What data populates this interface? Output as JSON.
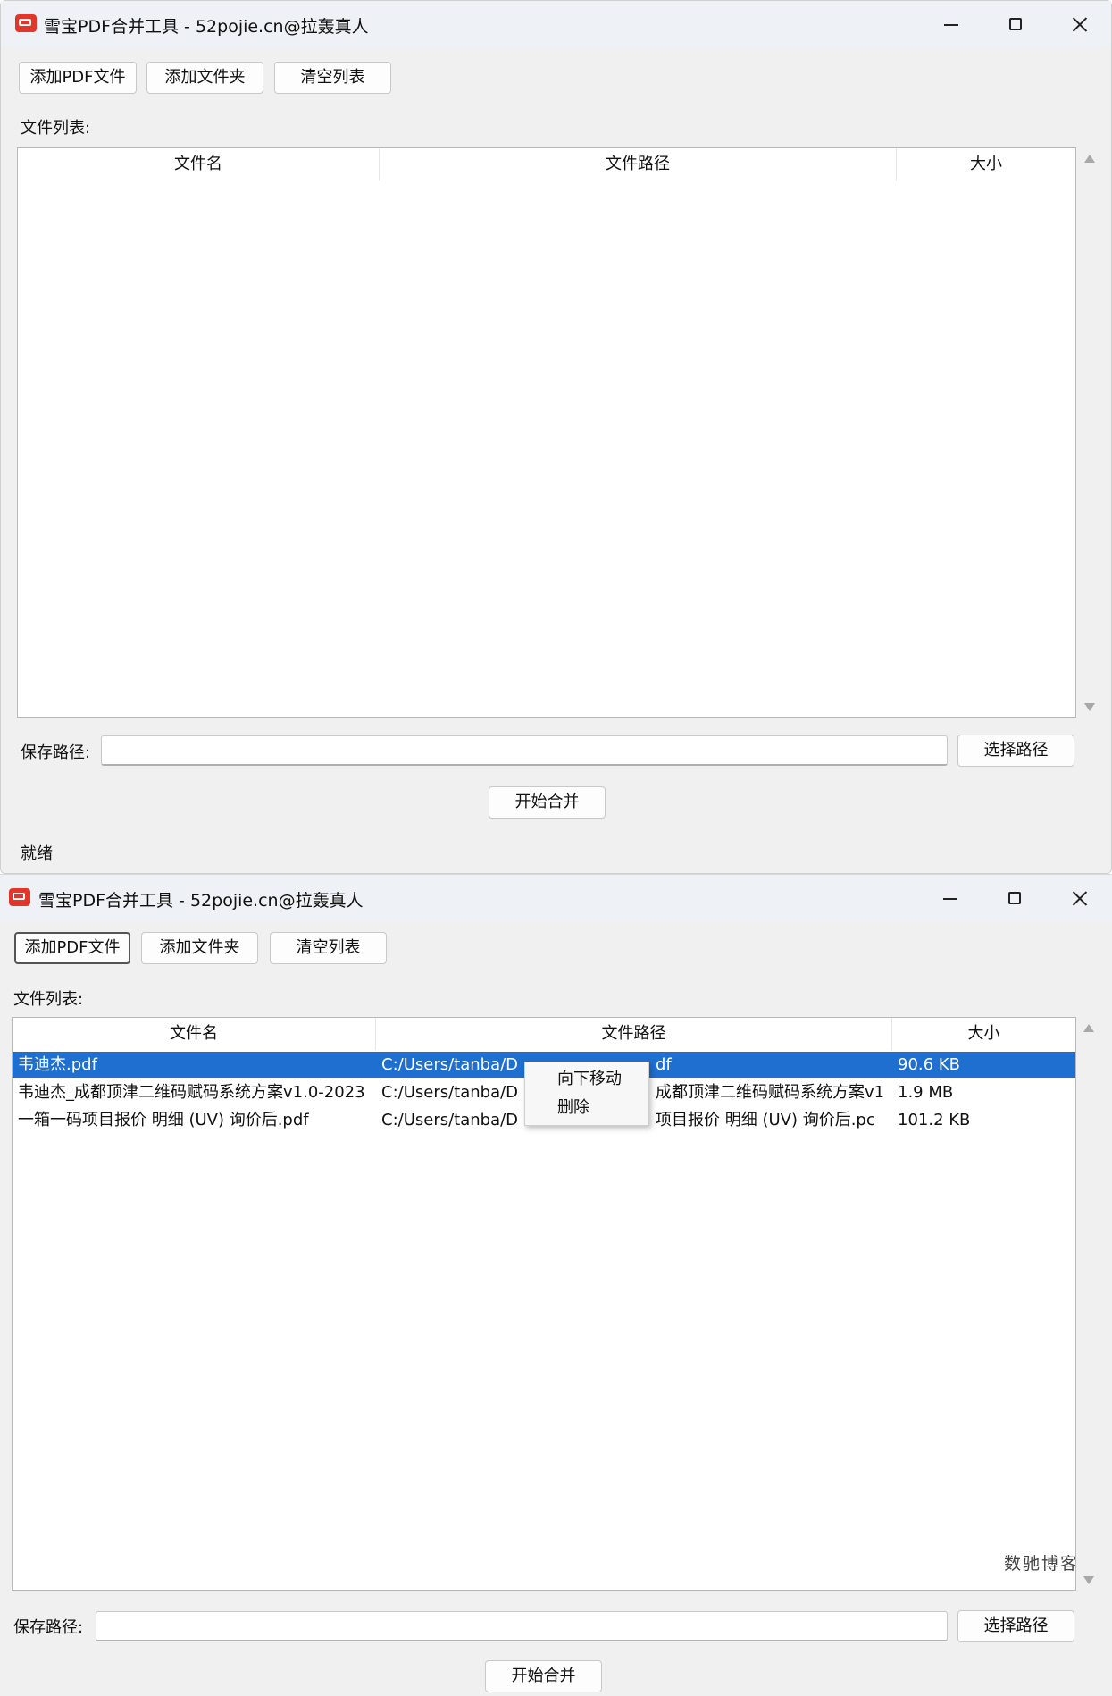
{
  "window_title": "雪宝PDF合并工具 - 52pojie.cn@拉轰真人",
  "toolbar": {
    "add_pdf": "添加PDF文件",
    "add_folder": "添加文件夹",
    "clear_list": "清空列表"
  },
  "file_list_label": "文件列表:",
  "columns": [
    "文件名",
    "文件路径",
    "大小"
  ],
  "save_path_label": "保存路径:",
  "save_path_value": "",
  "choose_path_button": "选择路径",
  "start_merge_button": "开始合并",
  "status_text": "就绪",
  "files": [
    {
      "name": "韦迪杰.pdf",
      "path": "C:/Users/tanba/D",
      "path_tail": "df",
      "size": "90.6 KB",
      "selected": true
    },
    {
      "name": "韦迪杰_成都顶津二维码赋码系统方案v1.0-2023",
      "path": "C:/Users/tanba/D",
      "path_tail": "成都顶津二维码赋码系统方案v1",
      "size": "1.9 MB",
      "selected": false
    },
    {
      "name": "一箱一码项目报价 明细 (UV) 询价后.pdf",
      "path": "C:/Users/tanba/D",
      "path_tail": "项目报价 明细 (UV) 询价后.pc",
      "size": "101.2 KB",
      "selected": false
    }
  ],
  "context_menu": [
    "向下移动",
    "删除"
  ],
  "watermark": "数驰博客",
  "colors": {
    "selection": "#1f6fd0",
    "app_icon": "#e2362b"
  }
}
